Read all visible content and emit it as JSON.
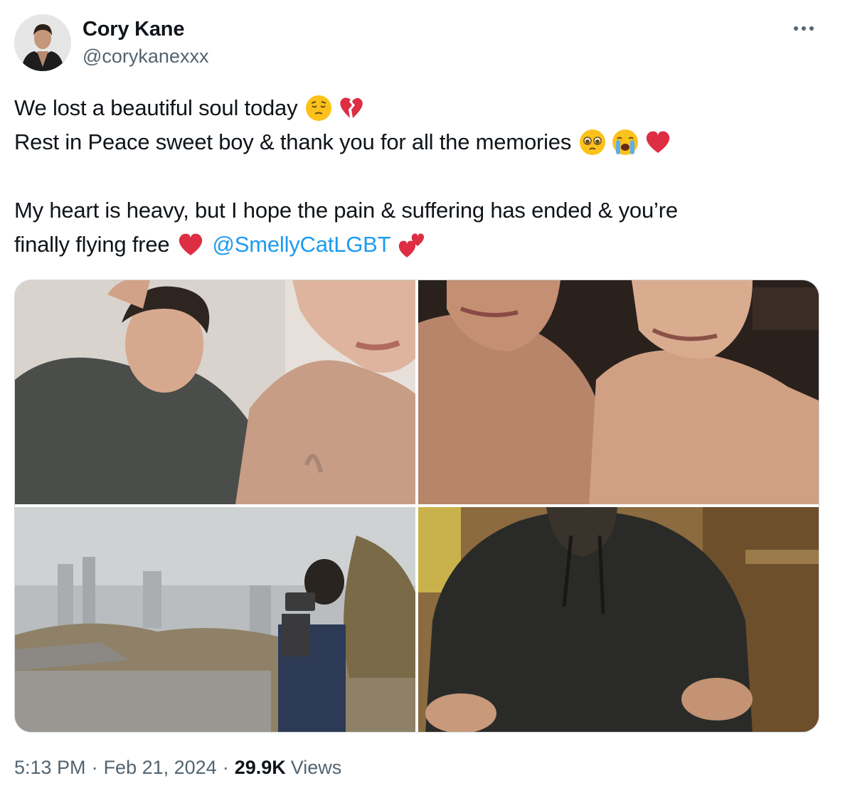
{
  "author": {
    "name": "Cory Kane",
    "handle": "@corykanexxx"
  },
  "tweet": {
    "line1": "We lost a beautiful soul today",
    "line1_emojis": [
      "pensive-face-icon",
      "broken-heart-icon"
    ],
    "line2": "Rest in Peace sweet boy & thank you for all the memories",
    "line2_emojis": [
      "pleading-face-icon",
      "loudly-crying-face-icon",
      "red-heart-icon"
    ],
    "line3": "My heart is heavy, but I hope the pain & suffering has ended & you’re",
    "line4": "finally flying free",
    "line4_emojis": [
      "red-heart-icon",
      "two-hearts-icon"
    ],
    "mention": "@SmellyCatLGBT",
    "mention_color": "#1d9bf0"
  },
  "media": {
    "count": 4,
    "photos": [
      "photo-1",
      "photo-2",
      "photo-3",
      "photo-4"
    ]
  },
  "footer": {
    "time": "5:13 PM",
    "separator": "·",
    "date": "Feb 21, 2024",
    "views_count": "29.9K",
    "views_label": "Views"
  },
  "colors": {
    "text": "#0f1419",
    "secondary": "#536471",
    "link": "#1d9bf0",
    "border": "#cfd9de"
  }
}
